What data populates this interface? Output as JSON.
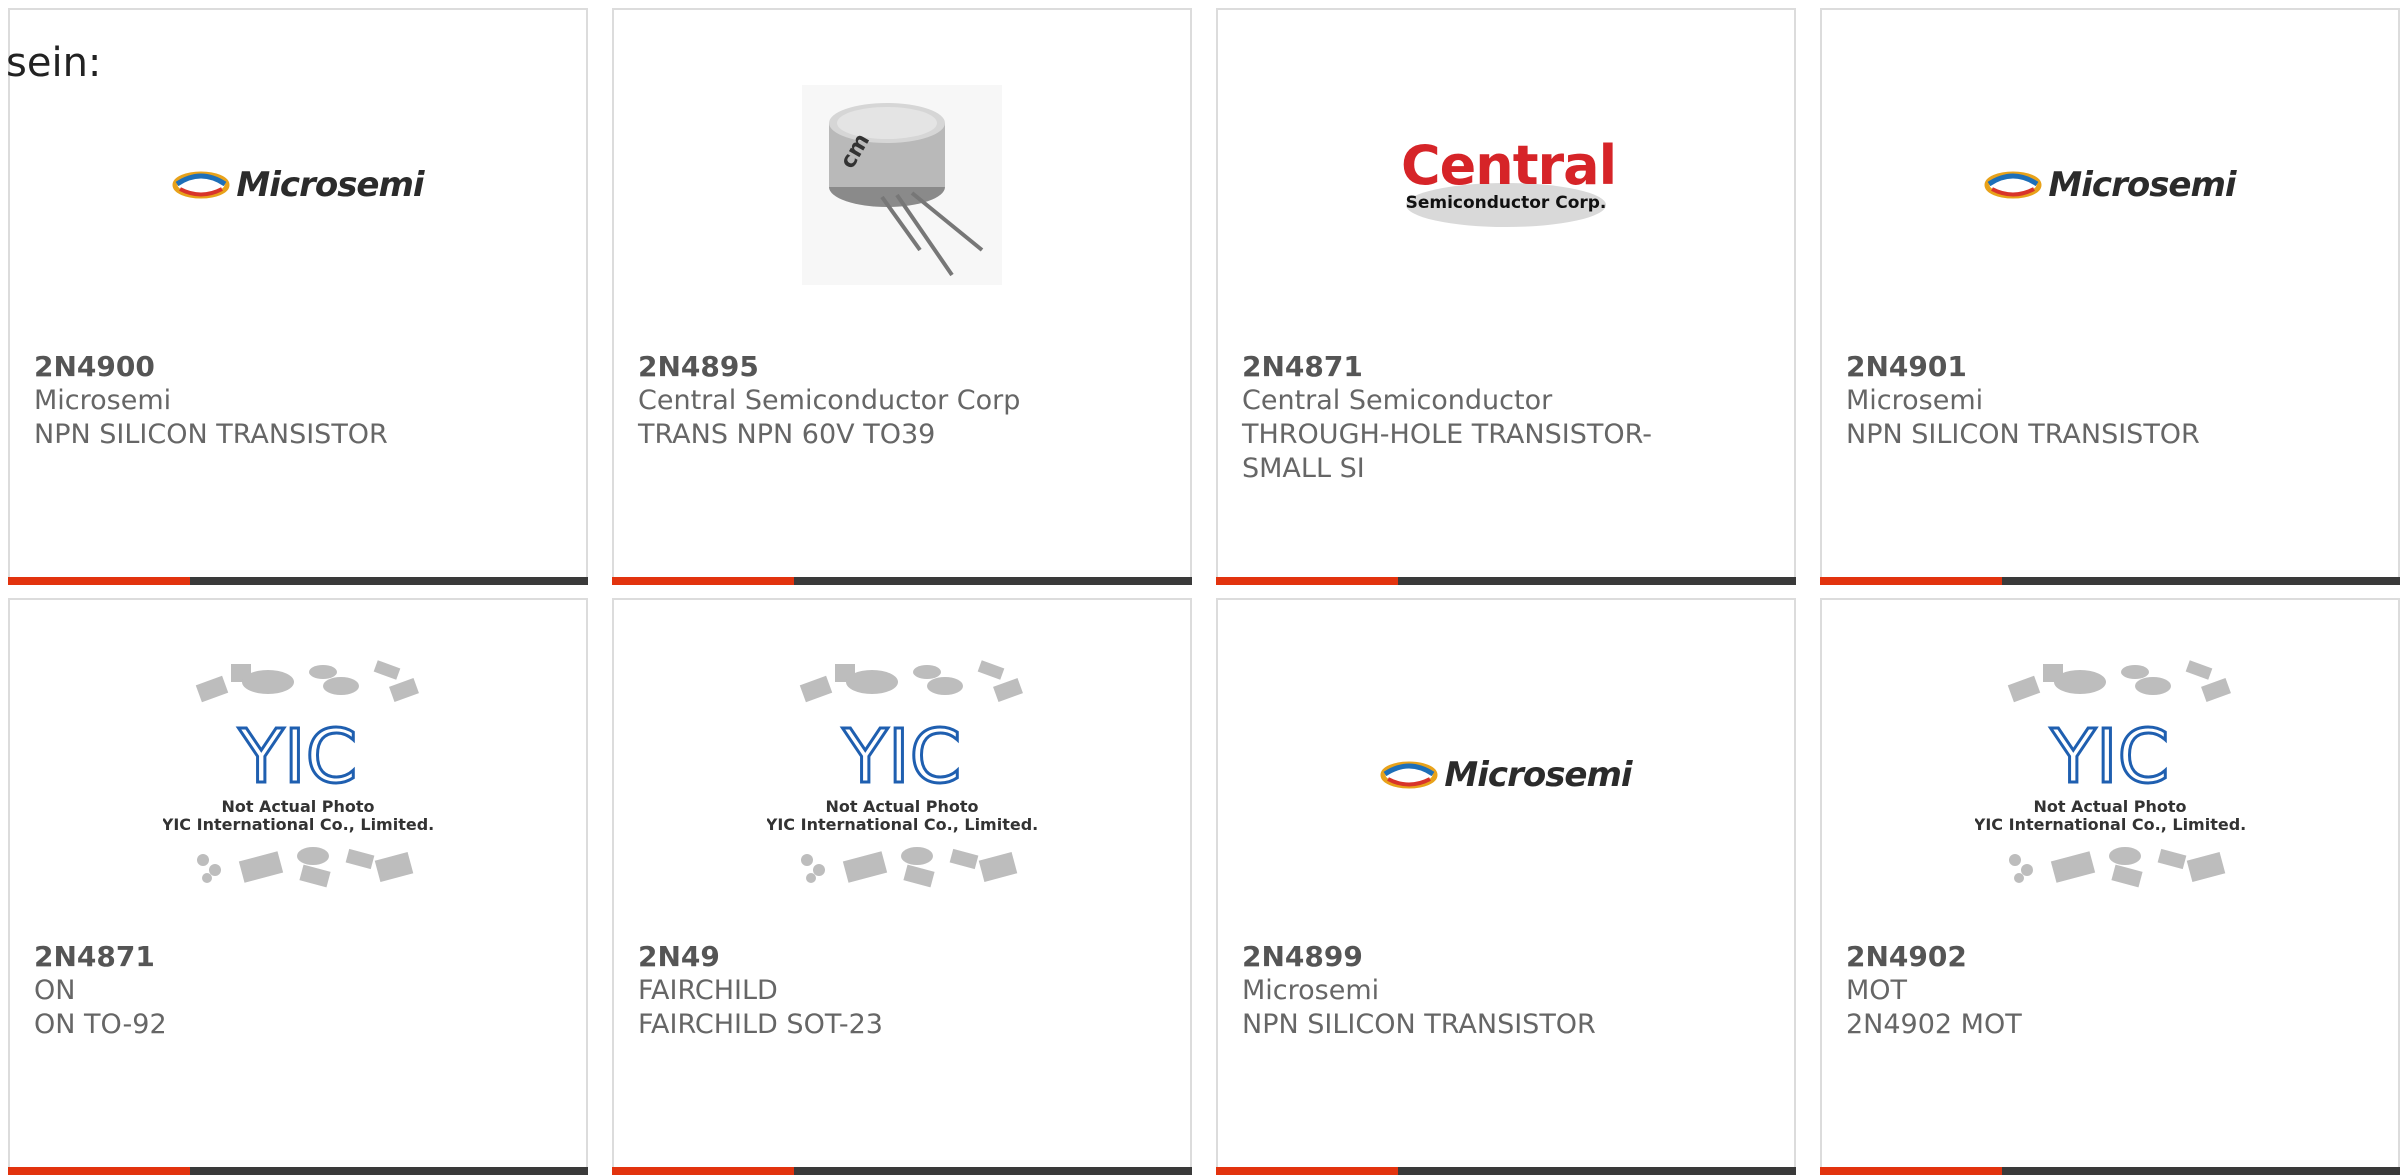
{
  "page": {
    "label": "sein:"
  },
  "colors": {
    "accent": "#e2330e",
    "bar": "#3a3a3a",
    "border": "#dcdcdc",
    "text": "#666666"
  },
  "products": [
    {
      "part": "2N4900",
      "manufacturer": "Microsemi",
      "description": "NPN SILICON TRANSISTOR",
      "image": "microsemi-logo",
      "logo_text": "Microsemi"
    },
    {
      "part": "2N4895",
      "manufacturer": "Central Semiconductor Corp",
      "description": "TRANS NPN 60V TO39",
      "image": "to39-transistor-photo",
      "logo_text": ""
    },
    {
      "part": "2N4871",
      "manufacturer": "Central Semiconductor",
      "description": "THROUGH-HOLE TRANSISTOR-SMALL SI",
      "image": "central-logo",
      "logo_text": "Central",
      "logo_sub": "Semiconductor Corp."
    },
    {
      "part": "2N4901",
      "manufacturer": "Microsemi",
      "description": "NPN SILICON TRANSISTOR",
      "image": "microsemi-logo",
      "logo_text": "Microsemi"
    },
    {
      "part": "2N4871",
      "manufacturer": "ON",
      "description": "ON TO-92",
      "image": "yic-placeholder",
      "caption1": "Not Actual Photo",
      "caption2": "YIC International Co., Limited."
    },
    {
      "part": "2N49",
      "manufacturer": "FAIRCHILD",
      "description": "FAIRCHILD SOT-23",
      "image": "yic-placeholder",
      "caption1": "Not Actual Photo",
      "caption2": "YIC International Co., Limited."
    },
    {
      "part": "2N4899",
      "manufacturer": "Microsemi",
      "description": "NPN SILICON TRANSISTOR",
      "image": "microsemi-logo",
      "logo_text": "Microsemi"
    },
    {
      "part": "2N4902",
      "manufacturer": "MOT",
      "description": "2N4902 MOT",
      "image": "yic-placeholder",
      "caption1": "Not Actual Photo",
      "caption2": "YIC International Co., Limited."
    }
  ]
}
